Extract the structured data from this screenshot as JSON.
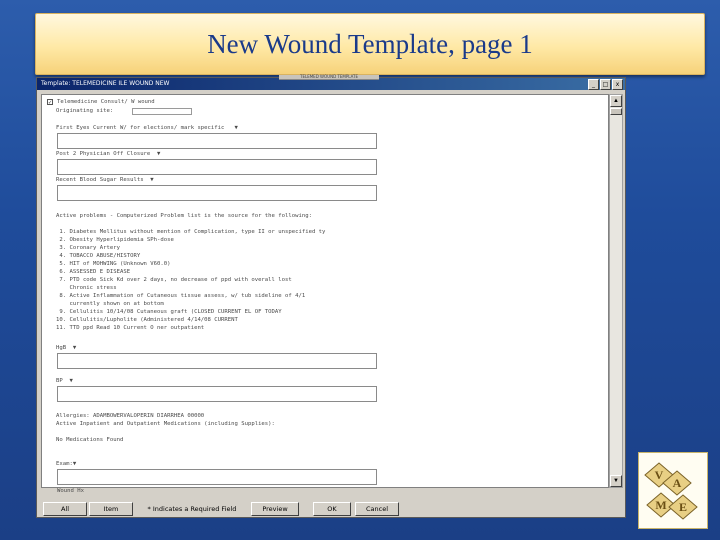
{
  "slide": {
    "title": "New Wound Template, page 1"
  },
  "window": {
    "title": "Template: TELEMEDICINE ILE WOUND NEW",
    "tab_hint": "TELEMED WOUND TEMPLATE",
    "minimize": "_",
    "maximize": "□",
    "close": "x"
  },
  "form": {
    "header_check": "Telemedicine Consult/ W wound",
    "origin_label": "Originating site:",
    "prompt1": "First Eyes Current W/ for elections/ mark specific   ▼",
    "prompt2": "Post 2 Physician Off Closure  ▼",
    "prompt3": "Recent Blood Sugar Results  ▼",
    "problems_heading": "Active problems - Computerized Problem list is the source for the following:",
    "problems": [
      " 1. Diabetes Mellitus without mention of Complication, type II or unspecified ty",
      " 2. Obesity Hyperlipidemia SPh-dose",
      " 3. Coronary Artery",
      " 4. TOBACCO ABUSE/HISTORY",
      " 5. HIT of MOHWING (Unknown V60.0)",
      " 6. ASSESSED E DISEASE",
      " 7. PTD code Sick Kd over 2 days, no decrease of ppd with overall lost",
      "    Chronic stress",
      " 8. Active Inflammation of Cutaneous tissue assess, w/ tub sideline of 4/1",
      "    currently shown on at bottom",
      " 9. Cellulitis 10/14/08 Cutaneous graft (CLOSED CURRENT EL OF TODAY",
      "10. Cellulitis/Lupholite (Administered 4/14/08 CURRENT",
      "11. TTD ppd Read 10 Current O ner outpatient"
    ],
    "label_hgb": "HgB  ▼",
    "label_bp": "BP  ▼",
    "allergies_line": "Allergies: ADAMBOWERVALOPERIN DIARRHEA 00000",
    "meds_line": "Active Inpatient and Outpatient Medications (including Supplies):",
    "no_meds": "No Medications Found",
    "label_exam": "Exam:▼",
    "footer_check": "Wound Hx"
  },
  "buttons": {
    "all": "All",
    "item": "Item",
    "required_note": "* Indicates a Required Field",
    "preview": "Preview",
    "ok": "OK",
    "cancel": "Cancel"
  },
  "logo": {
    "letters": [
      "V",
      "A",
      "M",
      "E"
    ],
    "accent": "#d9b45a"
  }
}
